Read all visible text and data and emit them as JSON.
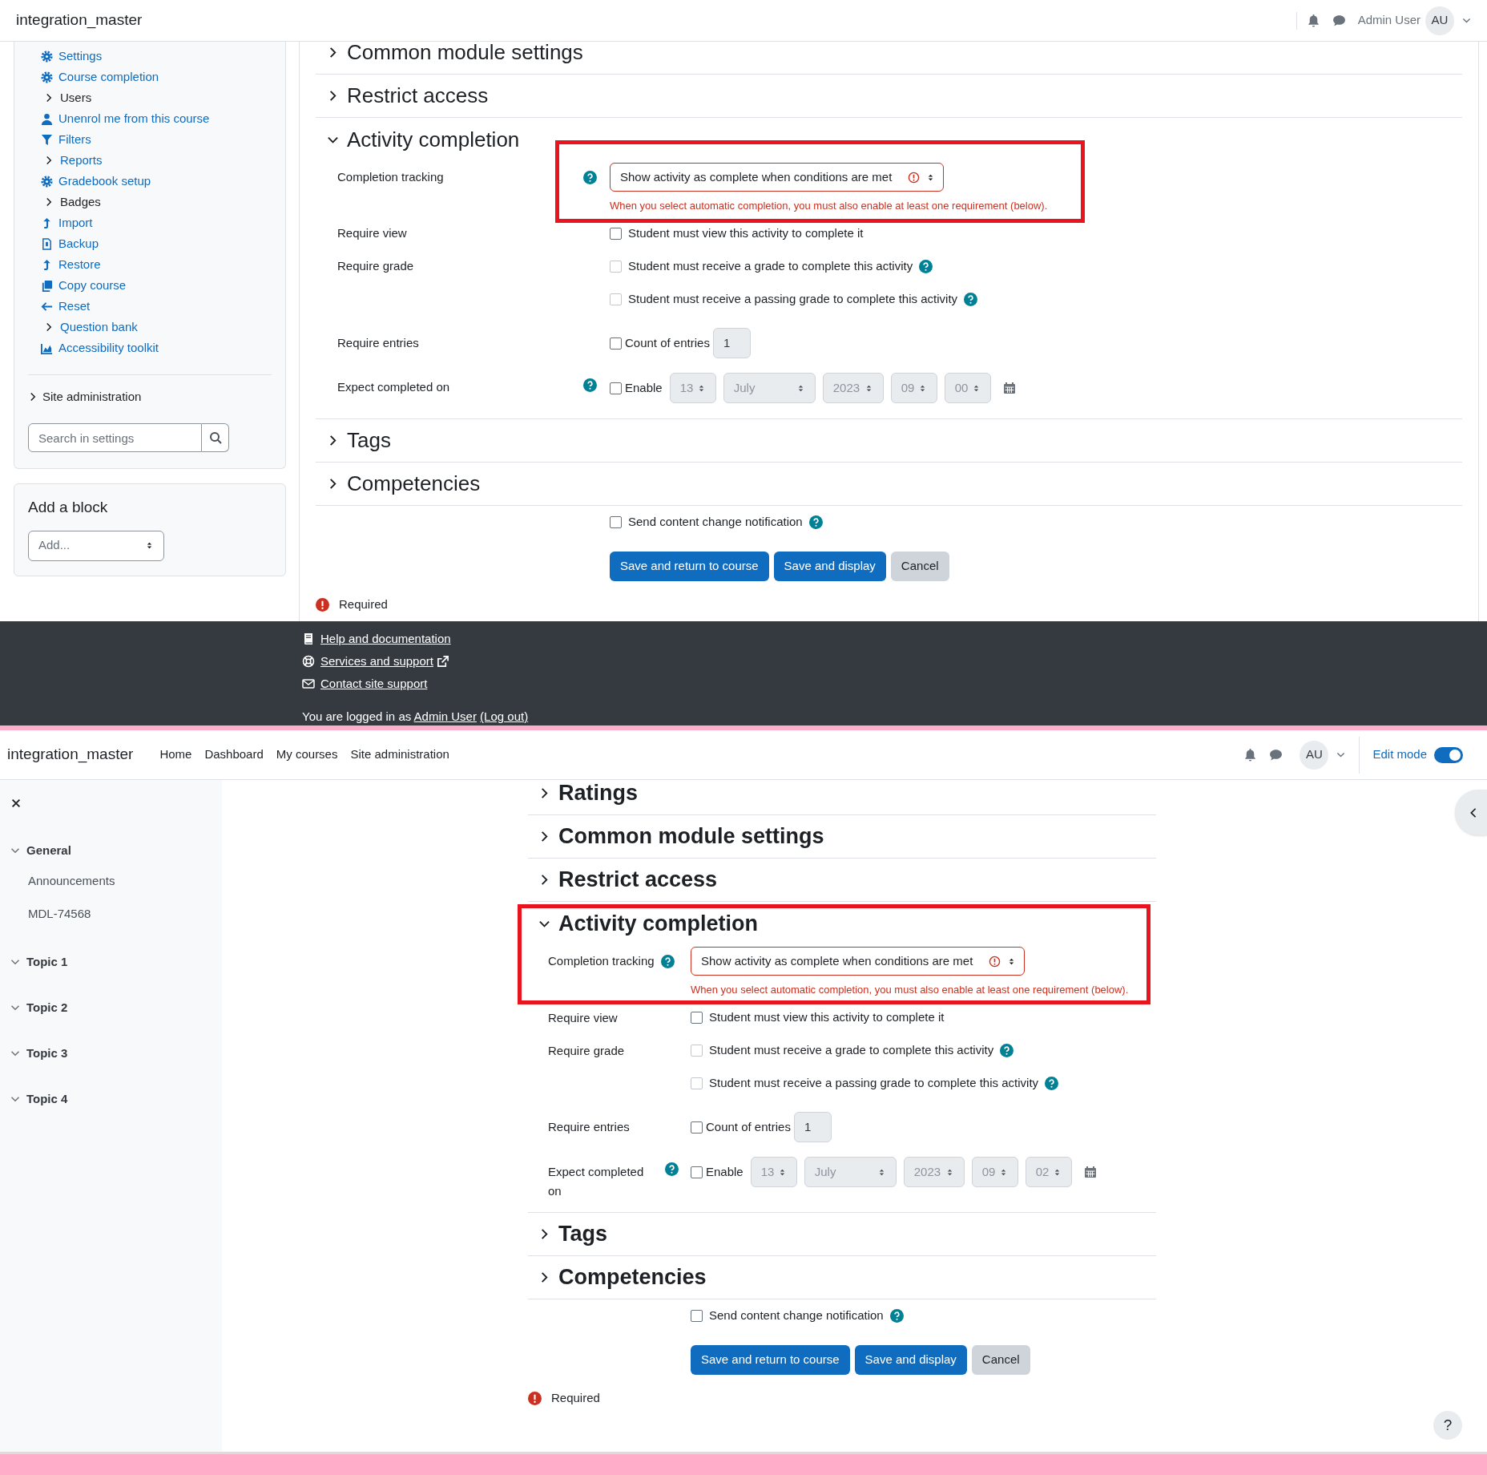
{
  "top_screen": {
    "header": {
      "brand": "integration_master",
      "user_name": "Admin User",
      "avatar": "AU"
    },
    "sidebar": {
      "items": [
        {
          "label": "Settings",
          "kind": "link"
        },
        {
          "label": "Course completion",
          "kind": "link"
        },
        {
          "label": "Users",
          "kind": "category"
        },
        {
          "label": "Unenrol me from this course",
          "kind": "link"
        },
        {
          "label": "Filters",
          "kind": "link"
        },
        {
          "label": "Reports",
          "kind": "branch"
        },
        {
          "label": "Gradebook setup",
          "kind": "link"
        },
        {
          "label": "Badges",
          "kind": "category"
        },
        {
          "label": "Import",
          "kind": "link"
        },
        {
          "label": "Backup",
          "kind": "link"
        },
        {
          "label": "Restore",
          "kind": "link"
        },
        {
          "label": "Copy course",
          "kind": "link"
        },
        {
          "label": "Reset",
          "kind": "link"
        },
        {
          "label": "Question bank",
          "kind": "branch"
        },
        {
          "label": "Accessibility toolkit",
          "kind": "link"
        }
      ],
      "site_administration": "Site administration",
      "search": {
        "placeholder": "Search in settings"
      }
    },
    "add_block": {
      "title": "Add a block",
      "select": "Add..."
    },
    "form": {
      "sections": [
        {
          "title": "Common module settings",
          "expanded": false
        },
        {
          "title": "Restrict access",
          "expanded": false
        },
        {
          "title": "Activity completion",
          "expanded": true,
          "fields": [
            {
              "kind": "select",
              "label": "Completion tracking",
              "help": true,
              "value": "Show activity as complete when conditions are met",
              "error": "When you select automatic completion, you must also enable at least one requirement (below).",
              "highlighted": true
            },
            {
              "kind": "checkboxes",
              "label": "Require view",
              "options": [
                {
                  "text": "Student must view this activity to complete it",
                  "checked": false,
                  "disabled": false,
                  "help": false
                }
              ]
            },
            {
              "kind": "checkboxes",
              "label": "Require grade",
              "options": [
                {
                  "text": "Student must receive a grade to complete this activity",
                  "checked": false,
                  "disabled": true,
                  "help": true
                },
                {
                  "text": "Student must receive a passing grade to complete this activity",
                  "checked": false,
                  "disabled": true,
                  "help": true
                }
              ]
            },
            {
              "kind": "count",
              "label": "Require entries",
              "checkbox_label": "Count of entries",
              "checked": false,
              "value": "1"
            },
            {
              "kind": "date",
              "label": "Expect completed on",
              "help": true,
              "checkbox_label": "Enable",
              "checked": false,
              "day": "13",
              "month": "July",
              "year": "2023",
              "hour": "09",
              "minute": "00"
            }
          ]
        },
        {
          "title": "Tags",
          "expanded": false
        },
        {
          "title": "Competencies",
          "expanded": false
        }
      ],
      "notification": {
        "text": "Send content change notification",
        "checked": false,
        "help": true
      },
      "buttons": [
        {
          "label": "Save and return to course",
          "kind": "primary"
        },
        {
          "label": "Save and display",
          "kind": "primary"
        },
        {
          "label": "Cancel",
          "kind": "secondary"
        }
      ],
      "required_note": "Required"
    },
    "footer": {
      "links": [
        {
          "text": "Help and documentation",
          "external": false
        },
        {
          "text": "Services and support",
          "external": true
        },
        {
          "text": "Contact site support",
          "external": false
        }
      ],
      "login_prefix": "You are logged in as",
      "login_user": "Admin User",
      "logout": "(Log out)"
    }
  },
  "bottom_screen": {
    "header": {
      "brand": "integration_master",
      "nav": [
        "Home",
        "Dashboard",
        "My courses",
        "Site administration"
      ],
      "avatar": "AU",
      "edit_mode": {
        "label": "Edit mode",
        "on": true
      }
    },
    "course_index": [
      {
        "title": "General",
        "expanded": true,
        "children": [
          {
            "title": "Announcements"
          },
          {
            "title": "MDL-74568"
          }
        ]
      },
      {
        "title": "Topic 1",
        "expanded": true
      },
      {
        "title": "Topic 2",
        "expanded": true
      },
      {
        "title": "Topic 3",
        "expanded": true
      },
      {
        "title": "Topic 4",
        "expanded": true
      }
    ],
    "form": {
      "sections": [
        {
          "title": "Ratings",
          "expanded": false
        },
        {
          "title": "Common module settings",
          "expanded": false
        },
        {
          "title": "Restrict access",
          "expanded": false
        },
        {
          "title": "Activity completion",
          "expanded": true,
          "fields": [
            {
              "kind": "select",
              "label": "Completion tracking",
              "help": true,
              "value": "Show activity as complete when conditions are met",
              "error": "When you select automatic completion, you must also enable at least one requirement (below).",
              "highlighted": true
            },
            {
              "kind": "checkboxes",
              "label": "Require view",
              "options": [
                {
                  "text": "Student must view this activity to complete it",
                  "checked": false,
                  "disabled": false,
                  "help": false
                }
              ]
            },
            {
              "kind": "checkboxes",
              "label": "Require grade",
              "options": [
                {
                  "text": "Student must receive a grade to complete this activity",
                  "checked": false,
                  "disabled": true,
                  "help": true
                },
                {
                  "text": "Student must receive a passing grade to complete this activity",
                  "checked": false,
                  "disabled": true,
                  "help": true
                }
              ]
            },
            {
              "kind": "count",
              "label": "Require entries",
              "checkbox_label": "Count of entries",
              "checked": false,
              "value": "1"
            },
            {
              "kind": "date",
              "label": "Expect completed on",
              "help": true,
              "checkbox_label": "Enable",
              "checked": false,
              "day": "13",
              "month": "July",
              "year": "2023",
              "hour": "09",
              "minute": "02"
            }
          ]
        },
        {
          "title": "Tags",
          "expanded": false
        },
        {
          "title": "Competencies",
          "expanded": false
        }
      ],
      "notification": {
        "text": "Send content change notification",
        "checked": false,
        "help": true
      },
      "buttons": [
        {
          "label": "Save and return to course",
          "kind": "primary"
        },
        {
          "label": "Save and display",
          "kind": "primary"
        },
        {
          "label": "Cancel",
          "kind": "secondary"
        }
      ],
      "required_note": "Required"
    },
    "help_button": "?"
  }
}
